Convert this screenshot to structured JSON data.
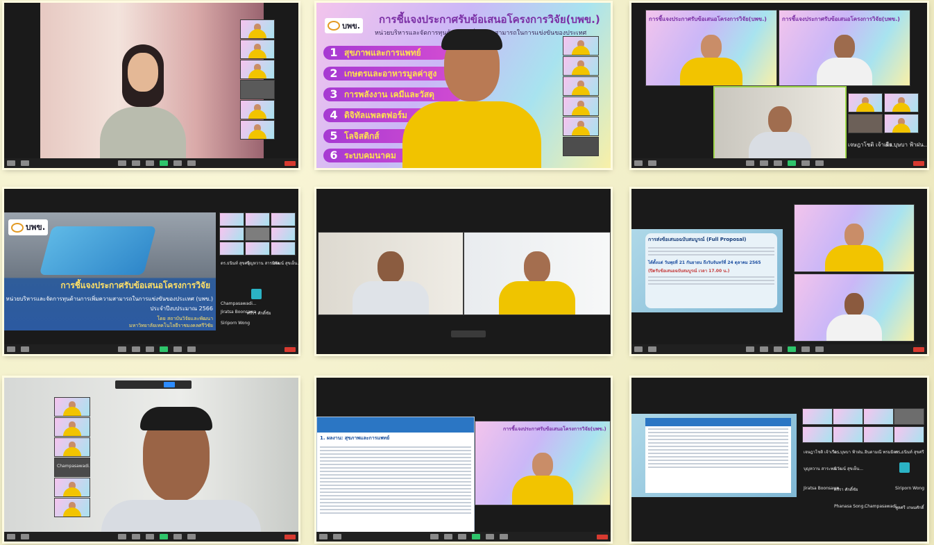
{
  "slides": {
    "main_title": "การชี้แจงประกาศรับข้อเสนอโครงการวิจัย(บพข.)",
    "main_subtitle": "หน่วยบริหารและจัดการทุนด้านการเพิ่มความสามารถในการแข่งขันของประเทศ",
    "items": [
      {
        "num": "1",
        "label": "สุขภาพและการแพทย์"
      },
      {
        "num": "2",
        "label": "เกษตรและอาหารมูลค่าสูง"
      },
      {
        "num": "3",
        "label": "การพลังงาน เคมีและวัสดุ"
      },
      {
        "num": "4",
        "label": "ดิจิทัลแพลตฟอร์ม"
      },
      {
        "num": "5",
        "label": "โลจิสติกส์"
      },
      {
        "num": "6",
        "label": "ระบบคมนาคม"
      }
    ],
    "logo": "บพข.",
    "announce_title": "การชี้แจงประกาศรับข้อเสนอโครงการวิจัย",
    "announce_org": "หน่วยบริหารและจัดการทุนด้านการเพิ่มความสามารถในการแข่งขันของประเทศ (บพข.)",
    "announce_year": "ประจำปีงบประมาณ 2566",
    "announce_by": "โดย สถาบันวิจัยและพัฒนา",
    "announce_univ": "มหาวิทยาลัยเทคโนโลยีราชมงคลศรีวิชัย",
    "full_proposal": "การส่งข้อเสนอฉบับสมบูรณ์ (Full Proposal)",
    "full_proposal_date": "ได้ตั้งแต่ วันพุธที่ 21 กันยายน ถึงวันจันทร์ที่ 24 ตุลาคม 2565",
    "full_proposal_deadline": "(ปิดรับข้อเสนอฉบับสมบูรณ์ เวลา 17.00 น.)",
    "section_heading": "1. ผลงาน: สุขภาพและการแพทย์"
  },
  "participants": [
    "เจษฎาโชติ เจ้าเรือ...",
    "ดร.บุษบา ฟ้าฝน...",
    "จินดามณี พรมมิตร...",
    "ดร.ธนินท์ สุขศรี",
    "บุญหวาน สาระพล",
    "นิวัฒน์ สุขเย็น...",
    "Champasawadi...",
    "Jiratsa Boonsawa",
    "ศรีรา ศักดิ์ชัย",
    "Siriporn Wong",
    "Phanasa Song...",
    "พูลศรี เกษมศักดิ์"
  ],
  "toolbar": {
    "mute": "Mute",
    "stop_video": "Stop Video",
    "security": "Security",
    "participants": "Participants",
    "chat": "Chat",
    "share_screen": "Share Screen",
    "record": "Record",
    "reactions": "Reactions",
    "apps": "Apps",
    "end": "End"
  },
  "colors": {
    "accent": "#a63ad2",
    "highlight": "#ffe34d",
    "shirt": "#f2c400",
    "end": "#d73a30",
    "frame": "#fffbe0"
  }
}
